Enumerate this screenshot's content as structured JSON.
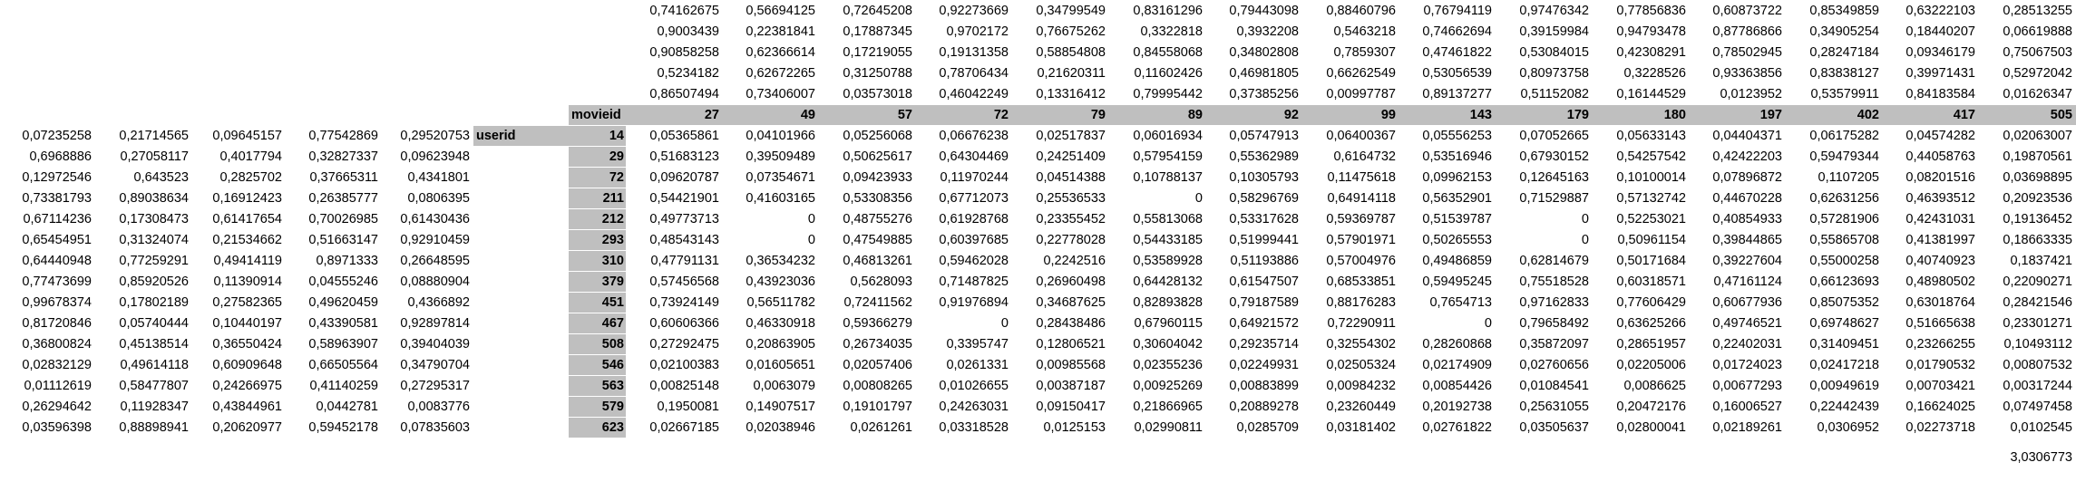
{
  "top_block": [
    [
      "0,74162675",
      "0,56694125",
      "0,72645208",
      "0,92273669",
      "0,34799549",
      "0,83161296",
      "0,79443098",
      "0,88460796",
      "0,76794119",
      "0,97476342",
      "0,77856836",
      "0,60873722",
      "0,85349859",
      "0,63222103",
      "0,28513255"
    ],
    [
      "0,9003439",
      "0,22381841",
      "0,17887345",
      "0,9702172",
      "0,76675262",
      "0,3322818",
      "0,3932208",
      "0,5463218",
      "0,74662694",
      "0,39159984",
      "0,94793478",
      "0,87786866",
      "0,34905254",
      "0,18440207",
      "0,06619888"
    ],
    [
      "0,90858258",
      "0,62366614",
      "0,17219055",
      "0,19131358",
      "0,58854808",
      "0,84558068",
      "0,34802808",
      "0,7859307",
      "0,47461822",
      "0,53084015",
      "0,42308291",
      "0,78502945",
      "0,28247184",
      "0,09346179",
      "0,75067503"
    ],
    [
      "0,5234182",
      "0,62672265",
      "0,31250788",
      "0,78706434",
      "0,21620311",
      "0,11602426",
      "0,46981805",
      "0,66262549",
      "0,53056539",
      "0,80973758",
      "0,3228526",
      "0,93363856",
      "0,83838127",
      "0,39971431",
      "0,52972042"
    ],
    [
      "0,86507494",
      "0,73406007",
      "0,03573018",
      "0,46042249",
      "0,13316412",
      "0,79995442",
      "0,37385256",
      "0,00997787",
      "0,89137277",
      "0,51152082",
      "0,16144529",
      "0,0123952",
      "0,53579911",
      "0,84183584",
      "0,01626347"
    ]
  ],
  "movieid_label": "movieid",
  "userid_label": "userid",
  "movie_ids": [
    "27",
    "49",
    "57",
    "72",
    "79",
    "89",
    "92",
    "99",
    "143",
    "179",
    "180",
    "197",
    "402",
    "417",
    "505"
  ],
  "rows": [
    {
      "left": [
        "0,07235258",
        "0,21714565",
        "0,09645157",
        "0,77542869",
        "0,29520753"
      ],
      "userid": "14",
      "vals": [
        "0,05365861",
        "0,04101966",
        "0,05256068",
        "0,06676238",
        "0,02517837",
        "0,06016934",
        "0,05747913",
        "0,06400367",
        "0,05556253",
        "0,07052665",
        "0,05633143",
        "0,04404371",
        "0,06175282",
        "0,04574282",
        "0,02063007"
      ]
    },
    {
      "left": [
        "0,6968886",
        "0,27058117",
        "0,4017794",
        "0,32827337",
        "0,09623948"
      ],
      "userid": "29",
      "vals": [
        "0,51683123",
        "0,39509489",
        "0,50625617",
        "0,64304469",
        "0,24251409",
        "0,57954159",
        "0,55362989",
        "0,6164732",
        "0,53516946",
        "0,67930152",
        "0,54257542",
        "0,42422203",
        "0,59479344",
        "0,44058763",
        "0,19870561"
      ]
    },
    {
      "left": [
        "0,12972546",
        "0,643523",
        "0,2825702",
        "0,37665311",
        "0,4341801"
      ],
      "userid": "72",
      "vals": [
        "0,09620787",
        "0,07354671",
        "0,09423933",
        "0,11970244",
        "0,04514388",
        "0,10788137",
        "0,10305793",
        "0,11475618",
        "0,09962153",
        "0,12645163",
        "0,10100014",
        "0,07896872",
        "0,1107205",
        "0,08201516",
        "0,03698895"
      ]
    },
    {
      "left": [
        "0,73381793",
        "0,89038634",
        "0,16912423",
        "0,26385777",
        "0,0806395"
      ],
      "userid": "211",
      "vals": [
        "0,54421901",
        "0,41603165",
        "0,53308356",
        "0,67712073",
        "0,25536533",
        "0",
        "0,58296769",
        "0,64914118",
        "0,56352901",
        "0,71529887",
        "0,57132742",
        "0,44670228",
        "0,62631256",
        "0,46393512",
        "0,20923536"
      ]
    },
    {
      "left": [
        "0,67114236",
        "0,17308473",
        "0,61417654",
        "0,70026985",
        "0,61430436"
      ],
      "userid": "212",
      "vals": [
        "0,49773713",
        "0",
        "0,48755276",
        "0,61928768",
        "0,23355452",
        "0,55813068",
        "0,53317628",
        "0,59369787",
        "0,51539787",
        "0",
        "0,52253021",
        "0,40854933",
        "0,57281906",
        "0,42431031",
        "0,19136452"
      ]
    },
    {
      "left": [
        "0,65454951",
        "0,31324074",
        "0,21534662",
        "0,51663147",
        "0,92910459"
      ],
      "userid": "293",
      "vals": [
        "0,48543143",
        "0",
        "0,47549885",
        "0,60397685",
        "0,22778028",
        "0,54433185",
        "0,51999441",
        "0,57901971",
        "0,50265553",
        "0",
        "0,50961154",
        "0,39844865",
        "0,55865708",
        "0,41381997",
        "0,18663335"
      ]
    },
    {
      "left": [
        "0,64440948",
        "0,77259291",
        "0,49414119",
        "0,8971333",
        "0,26648595"
      ],
      "userid": "310",
      "vals": [
        "0,47791131",
        "0,36534232",
        "0,46813261",
        "0,59462028",
        "0,2242516",
        "0,53589928",
        "0,51193886",
        "0,57004976",
        "0,49486859",
        "0,62814679",
        "0,50171684",
        "0,39227604",
        "0,55000258",
        "0,40740923",
        "0,1837421"
      ]
    },
    {
      "left": [
        "0,77473699",
        "0,85920526",
        "0,11390914",
        "0,04555246",
        "0,08880904"
      ],
      "userid": "379",
      "vals": [
        "0,57456568",
        "0,43923036",
        "0,5628093",
        "0,71487825",
        "0,26960498",
        "0,64428132",
        "0,61547507",
        "0,68533851",
        "0,59495245",
        "0,75518528",
        "0,60318571",
        "0,47161124",
        "0,66123693",
        "0,48980502",
        "0,22090271"
      ]
    },
    {
      "left": [
        "0,99678374",
        "0,17802189",
        "0,27582365",
        "0,49620459",
        "0,4366892"
      ],
      "userid": "451",
      "vals": [
        "0,73924149",
        "0,56511782",
        "0,72411562",
        "0,91976894",
        "0,34687625",
        "0,82893828",
        "0,79187589",
        "0,88176283",
        "0,7654713",
        "0,97162833",
        "0,77606429",
        "0,60677936",
        "0,85075352",
        "0,63018764",
        "0,28421546"
      ]
    },
    {
      "left": [
        "0,81720846",
        "0,05740444",
        "0,10440197",
        "0,43390581",
        "0,92897814"
      ],
      "userid": "467",
      "vals": [
        "0,60606366",
        "0,46330918",
        "0,59366279",
        "0",
        "0,28438486",
        "0,67960115",
        "0,64921572",
        "0,72290911",
        "0",
        "0,79658492",
        "0,63625266",
        "0,49746521",
        "0,69748627",
        "0,51665638",
        "0,23301271"
      ]
    },
    {
      "left": [
        "0,36800824",
        "0,45138514",
        "0,36550424",
        "0,58963907",
        "0,39404039"
      ],
      "userid": "508",
      "vals": [
        "0,27292475",
        "0,20863905",
        "0,26734035",
        "0,3395747",
        "0,12806521",
        "0,30604042",
        "0,29235714",
        "0,32554302",
        "0,28260868",
        "0,35872097",
        "0,28651957",
        "0,22402031",
        "0,31409451",
        "0,23266255",
        "0,10493112"
      ]
    },
    {
      "left": [
        "0,02832129",
        "0,49614118",
        "0,60909648",
        "0,66505564",
        "0,34790704"
      ],
      "userid": "546",
      "vals": [
        "0,02100383",
        "0,01605651",
        "0,02057406",
        "0,0261331",
        "0,00985568",
        "0,02355236",
        "0,02249931",
        "0,02505324",
        "0,02174909",
        "0,02760656",
        "0,02205006",
        "0,01724023",
        "0,02417218",
        "0,01790532",
        "0,00807532"
      ]
    },
    {
      "left": [
        "0,01112619",
        "0,58477807",
        "0,24266975",
        "0,41140259",
        "0,27295317"
      ],
      "userid": "563",
      "vals": [
        "0,00825148",
        "0,0063079",
        "0,00808265",
        "0,01026655",
        "0,00387187",
        "0,00925269",
        "0,00883899",
        "0,00984232",
        "0,00854426",
        "0,01084541",
        "0,0086625",
        "0,00677293",
        "0,00949619",
        "0,00703421",
        "0,00317244"
      ]
    },
    {
      "left": [
        "0,26294642",
        "0,11928347",
        "0,43844961",
        "0,0442781",
        "0,0083776"
      ],
      "userid": "579",
      "vals": [
        "0,1950081",
        "0,14907517",
        "0,19101797",
        "0,24263031",
        "0,09150417",
        "0,21866965",
        "0,20889278",
        "0,23260449",
        "0,20192738",
        "0,25631055",
        "0,20472176",
        "0,16006527",
        "0,22442439",
        "0,16624025",
        "0,07497458"
      ]
    },
    {
      "left": [
        "0,03596398",
        "0,88898941",
        "0,20620977",
        "0,59452178",
        "0,07835603"
      ],
      "userid": "623",
      "vals": [
        "0,02667185",
        "0,02038946",
        "0,0261261",
        "0,03318528",
        "0,0125153",
        "0,02990811",
        "0,0285709",
        "0,03181402",
        "0,02761822",
        "0,03505637",
        "0,02800041",
        "0,02189261",
        "0,0306952",
        "0,02273718",
        "0,0102545"
      ]
    }
  ],
  "total_value": "3,0306773"
}
